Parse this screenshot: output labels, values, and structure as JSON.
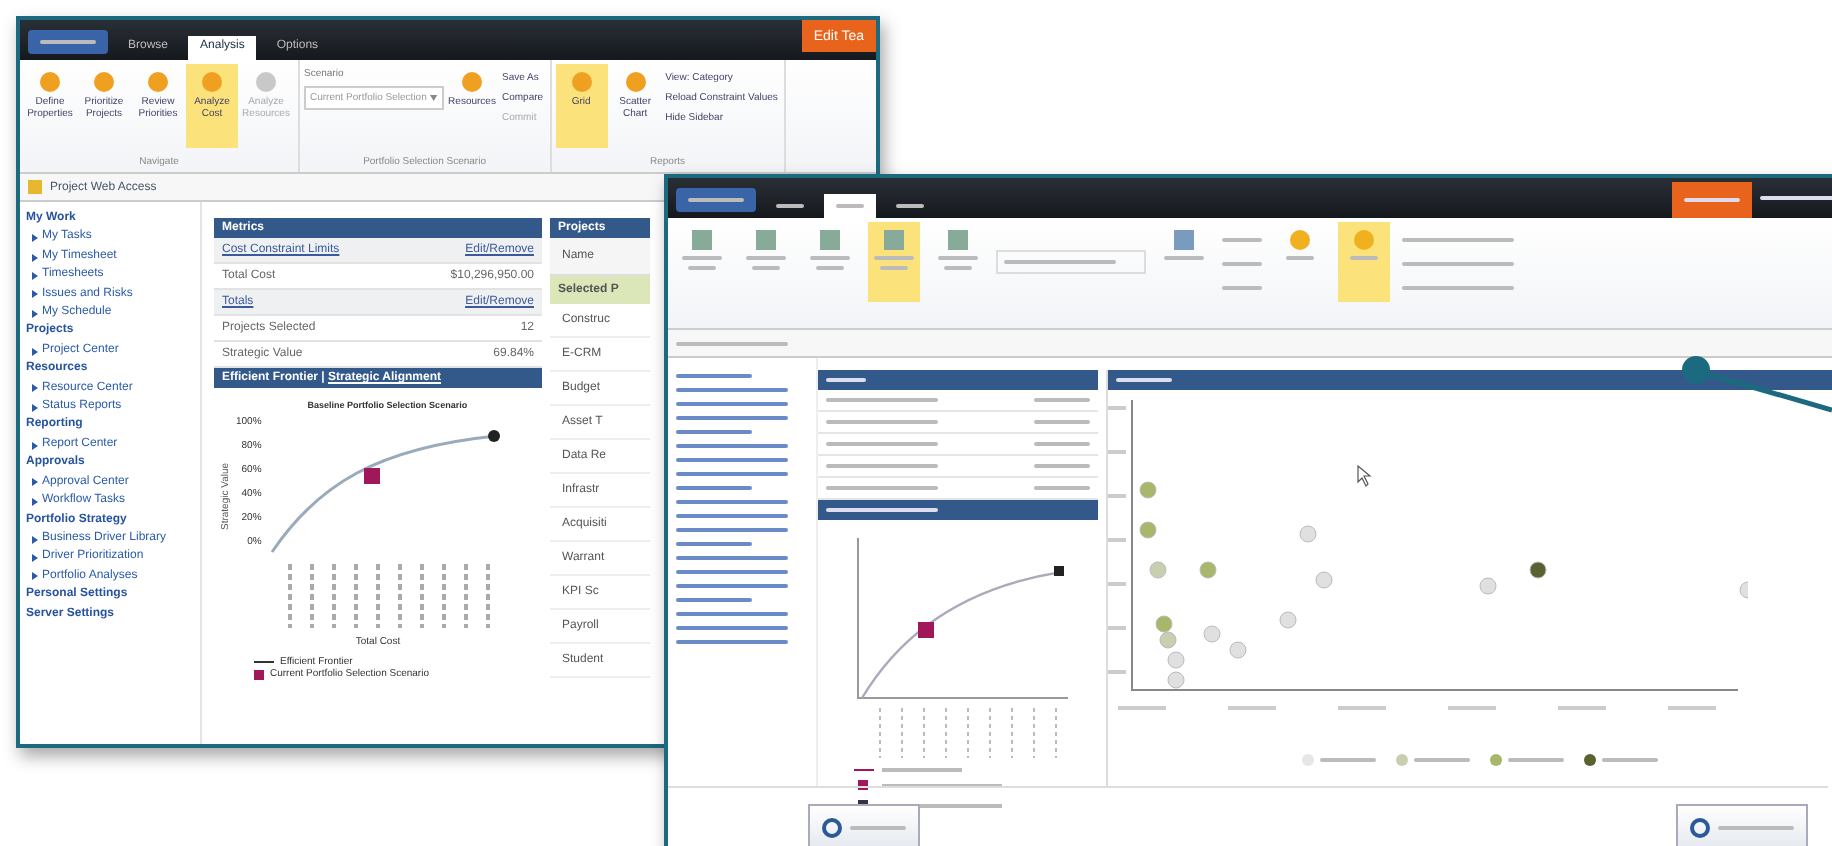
{
  "back_window": {
    "tabs": [
      {
        "label": "Browse",
        "selected": false
      },
      {
        "label": "Analysis",
        "selected": true
      },
      {
        "label": "Options",
        "selected": false
      }
    ],
    "action_button": "Edit Tea",
    "ribbon": [
      {
        "label": "Navigate",
        "items": [
          {
            "kind": "large",
            "label": "Define Properties",
            "highlighted": false,
            "disabled": false
          },
          {
            "kind": "large",
            "label": "Prioritize Projects",
            "highlighted": false,
            "disabled": false
          },
          {
            "kind": "large",
            "label": "Review Priorities",
            "highlighted": false,
            "disabled": false
          },
          {
            "kind": "large",
            "label": "Analyze Cost",
            "highlighted": true,
            "disabled": false
          },
          {
            "kind": "large",
            "label": "Analyze Resources",
            "highlighted": false,
            "disabled": true
          }
        ]
      },
      {
        "label": "Portfolio Selection Scenario",
        "items": [
          {
            "kind": "field",
            "label": "Scenario",
            "value": "Current Portfolio Selection"
          },
          {
            "kind": "large",
            "label": "Resources",
            "highlighted": false,
            "disabled": false
          },
          {
            "kind": "small",
            "label": "Save As",
            "disabled": false
          },
          {
            "kind": "small",
            "label": "Compare",
            "disabled": false
          },
          {
            "kind": "small",
            "label": "Commit",
            "disabled": true
          }
        ]
      },
      {
        "label": "Reports",
        "items": [
          {
            "kind": "large",
            "label": "Grid",
            "highlighted": true,
            "disabled": false
          },
          {
            "kind": "large",
            "label": "Scatter Chart",
            "highlighted": false,
            "disabled": false
          },
          {
            "kind": "small",
            "label": "View: Category",
            "disabled": false
          },
          {
            "kind": "small",
            "label": "Reload Constraint Values",
            "disabled": false
          },
          {
            "kind": "small",
            "label": "Hide Sidebar",
            "disabled": false
          }
        ]
      }
    ],
    "breadcrumb": "Project Web Access",
    "sidebar": [
      {
        "label": "My Work",
        "children": [
          {
            "label": "My Tasks"
          },
          {
            "label": "My Timesheet"
          },
          {
            "label": "Timesheets"
          },
          {
            "label": "Issues and Risks"
          },
          {
            "label": "My Schedule"
          }
        ]
      },
      {
        "label": "Projects",
        "children": [
          {
            "label": "Project Center"
          }
        ]
      },
      {
        "label": "Resources",
        "children": [
          {
            "label": "Resource Center"
          },
          {
            "label": "Status Reports"
          }
        ]
      },
      {
        "label": "Reporting",
        "children": [
          {
            "label": "Report Center"
          }
        ]
      },
      {
        "label": "Approvals",
        "children": [
          {
            "label": "Approval Center"
          },
          {
            "label": "Workflow Tasks"
          }
        ]
      },
      {
        "label": "Portfolio Strategy",
        "children": [
          {
            "label": "Business Driver Library"
          },
          {
            "label": "Driver Prioritization"
          },
          {
            "label": "Portfolio Analyses"
          }
        ]
      },
      {
        "label": "Personal Settings"
      },
      {
        "label": "Server Settings"
      }
    ],
    "metrics": {
      "title": "Metrics",
      "rows": [
        {
          "label": "Cost Constraint Limits",
          "value": "Edit/Remove",
          "kind": "link"
        },
        {
          "label": "Total Cost",
          "value": "$10,296,950.00",
          "kind": "value"
        },
        {
          "label": "Totals",
          "value": "Edit/Remove",
          "kind": "link"
        },
        {
          "label": "Projects Selected",
          "value": "12",
          "kind": "value"
        },
        {
          "label": "Strategic Value",
          "value": "69.84%",
          "kind": "value"
        }
      ]
    },
    "frontier": {
      "title": "Efficient Frontier",
      "separator": "|",
      "link": "Strategic Alignment",
      "ylabel": "Strategic Value",
      "yticks": [
        "100%",
        "80%",
        "60%",
        "40%",
        "20%",
        "0%"
      ],
      "xlabel": "Total Cost",
      "annotation": "Baseline Portfolio Selection Scenario",
      "legend": [
        "Efficient Frontier",
        "Current Portfolio Selection Scenario"
      ]
    },
    "projects": {
      "title": "Projects",
      "column": "Name",
      "group": "Selected P",
      "rows": [
        "Construc",
        "E-CRM",
        "Budget",
        "Asset T",
        "Data Re",
        "Infrastr",
        "Acquisiti",
        "Warrant",
        "KPI Sc",
        "Payroll",
        "Student"
      ]
    }
  },
  "front_window": {
    "tabs": [
      {
        "selected": false
      },
      {
        "selected": true
      },
      {
        "selected": false
      }
    ],
    "ribbon_items": [
      {
        "highlighted": false
      },
      {
        "highlighted": false
      },
      {
        "highlighted": false
      },
      {
        "highlighted": true
      },
      {
        "highlighted": false
      }
    ],
    "report_items": [
      {
        "highlighted": false
      },
      {
        "highlighted": true
      }
    ],
    "scatter_legend": [
      {
        "color": "#e6e6e6"
      },
      {
        "color": "#c8cfb0"
      },
      {
        "color": "#a8b86a"
      },
      {
        "color": "#5b6130"
      }
    ]
  }
}
